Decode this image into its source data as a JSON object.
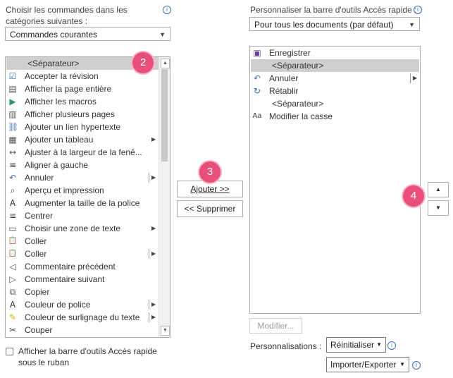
{
  "left": {
    "choose_label_line1": "Choisir les commandes dans les",
    "choose_label_line2": "catégories suivantes :",
    "category_value": "Commandes courantes",
    "items": [
      {
        "label": "<Séparateur>",
        "icon": "",
        "selected": true,
        "submenu": false
      },
      {
        "label": "Accepter la révision",
        "icon": "accept-revision-icon"
      },
      {
        "label": "Afficher la page entière",
        "icon": "full-page-icon"
      },
      {
        "label": "Afficher les macros",
        "icon": "play-macro-icon"
      },
      {
        "label": "Afficher plusieurs pages",
        "icon": "multiple-pages-icon"
      },
      {
        "label": "Ajouter un lien hypertexte",
        "icon": "hyperlink-icon"
      },
      {
        "label": "Ajouter un tableau",
        "icon": "table-icon",
        "submenu": "arrow"
      },
      {
        "label": "Ajuster à la largeur de la fenê...",
        "icon": "fit-width-icon"
      },
      {
        "label": "Aligner à gauche",
        "icon": "align-left-icon"
      },
      {
        "label": "Annuler",
        "icon": "undo-icon",
        "submenu": "split"
      },
      {
        "label": "Aperçu et impression",
        "icon": "print-preview-icon"
      },
      {
        "label": "Augmenter la taille de la police",
        "icon": "grow-font-icon"
      },
      {
        "label": "Centrer",
        "icon": "center-align-icon"
      },
      {
        "label": "Choisir une zone de texte",
        "icon": "text-box-icon",
        "submenu": "arrow"
      },
      {
        "label": "Coller",
        "icon": "paste-icon"
      },
      {
        "label": "Coller",
        "icon": "paste-icon",
        "submenu": "split"
      },
      {
        "label": "Commentaire précédent",
        "icon": "previous-comment-icon"
      },
      {
        "label": "Commentaire suivant",
        "icon": "next-comment-icon"
      },
      {
        "label": "Copier",
        "icon": "copy-icon"
      },
      {
        "label": "Couleur de police",
        "icon": "font-color-icon",
        "submenu": "split"
      },
      {
        "label": "Couleur de surlignage du texte",
        "icon": "highlight-icon",
        "submenu": "split"
      },
      {
        "label": "Couper",
        "icon": "cut-icon"
      }
    ],
    "show_below_line1": "Afficher la barre d'outils Accès rapide",
    "show_below_line2": "sous le ruban"
  },
  "middle": {
    "add_label": "Ajouter >>",
    "remove_label": "<< Supprimer"
  },
  "right": {
    "customize_label": "Personnaliser la barre d'outils Accès rapide :",
    "scope_value": "Pour tous les documents (par défaut)",
    "items": [
      {
        "label": "Enregistrer",
        "icon": "save-icon",
        "indent": false
      },
      {
        "label": "<Séparateur>",
        "icon": "",
        "selected": true,
        "indent": true
      },
      {
        "label": "Annuler",
        "icon": "undo-icon",
        "submenu": "split"
      },
      {
        "label": "Rétablir",
        "icon": "redo-icon"
      },
      {
        "label": "<Séparateur>",
        "icon": "",
        "indent": true
      },
      {
        "label": "Modifier la casse",
        "icon": "change-case-icon"
      }
    ],
    "modify_label": "Modifier...",
    "customizations_label": "Personnalisations :",
    "reset_label": "Réinitialiser",
    "import_export_label": "Importer/Exporter"
  },
  "badges": {
    "two": "2",
    "three": "3",
    "four": "4"
  },
  "colors": {
    "badge": "#e8507a",
    "selection": "#cfcfcf",
    "info_blue": "#3b6fb6"
  }
}
